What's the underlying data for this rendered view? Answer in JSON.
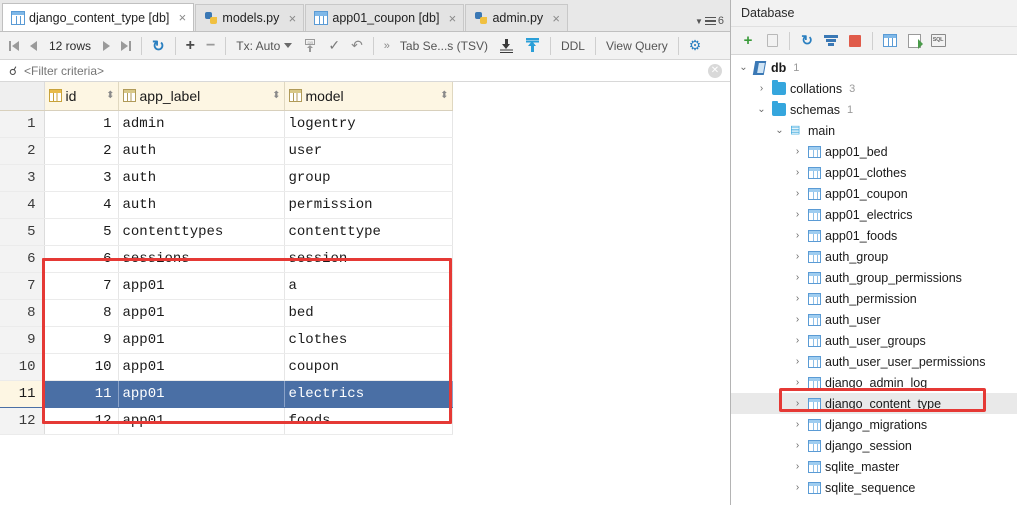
{
  "window": {
    "editor_tabs": [
      {
        "label": "django_content_type [db]",
        "icon": "db-table-icon",
        "active": true,
        "closable": true
      },
      {
        "label": "models.py",
        "icon": "python-file-icon",
        "active": false,
        "closable": true
      },
      {
        "label": "app01_coupon [db]",
        "icon": "db-table-icon",
        "active": false,
        "closable": true
      },
      {
        "label": "admin.py",
        "icon": "python-file-icon",
        "active": false,
        "closable": true
      }
    ],
    "tab_overflow_count": "6"
  },
  "toolbar": {
    "first_page_tooltip": "First page",
    "prev_page_tooltip": "Previous page",
    "row_count": "12 rows",
    "next_page_tooltip": "Next page",
    "last_page_tooltip": "Last page",
    "reload_tooltip": "Reload page",
    "add_row_label": "+",
    "delete_row_label": "−",
    "transaction_mode": "Tx: Auto",
    "export_db_tooltip": "Export to database",
    "submit_tooltip": "Submit",
    "revert_tooltip": "Revert",
    "more_label": "»",
    "csv_format": "Tab Se...s (TSV)",
    "import_tooltip": "Import data",
    "export_tooltip": "Export data",
    "ddl_label": "DDL",
    "view_query_label": "View Query",
    "settings_tooltip": "Data extractor settings"
  },
  "filter": {
    "icon": "filter-icon",
    "placeholder": "<Filter criteria>",
    "value": "",
    "clear_icon": "clear-icon"
  },
  "grid": {
    "columns": [
      {
        "key": "rownum",
        "label": "",
        "icon": null,
        "sortable": false
      },
      {
        "key": "id",
        "label": "id",
        "icon": "primary-key-column-icon",
        "sortable": true
      },
      {
        "key": "app_label",
        "label": "app_label",
        "icon": "column-icon",
        "sortable": true
      },
      {
        "key": "model",
        "label": "model",
        "icon": "column-icon",
        "sortable": true
      }
    ],
    "sort_mark": "⬍",
    "rows": [
      {
        "rownum": "1",
        "id": "1",
        "app_label": "admin",
        "model": "logentry",
        "selected": false
      },
      {
        "rownum": "2",
        "id": "2",
        "app_label": "auth",
        "model": "user",
        "selected": false
      },
      {
        "rownum": "3",
        "id": "3",
        "app_label": "auth",
        "model": "group",
        "selected": false
      },
      {
        "rownum": "4",
        "id": "4",
        "app_label": "auth",
        "model": "permission",
        "selected": false
      },
      {
        "rownum": "5",
        "id": "5",
        "app_label": "contenttypes",
        "model": "contenttype",
        "selected": false
      },
      {
        "rownum": "6",
        "id": "6",
        "app_label": "sessions",
        "model": "session",
        "selected": false
      },
      {
        "rownum": "7",
        "id": "7",
        "app_label": "app01",
        "model": "a",
        "selected": false
      },
      {
        "rownum": "8",
        "id": "8",
        "app_label": "app01",
        "model": "bed",
        "selected": false
      },
      {
        "rownum": "9",
        "id": "9",
        "app_label": "app01",
        "model": "clothes",
        "selected": false
      },
      {
        "rownum": "10",
        "id": "10",
        "app_label": "app01",
        "model": "coupon",
        "selected": false
      },
      {
        "rownum": "11",
        "id": "11",
        "app_label": "app01",
        "model": "electrics",
        "selected": true
      },
      {
        "rownum": "12",
        "id": "12",
        "app_label": "app01",
        "model": "foods",
        "selected": false
      }
    ],
    "selection_color": "#4a6fa5",
    "highlight_box_color": "#e53935"
  },
  "database_panel": {
    "title": "Database",
    "toolbar": [
      {
        "name": "add-data-source-button",
        "icon": "plus-icon"
      },
      {
        "name": "duplicate-button",
        "icon": "copy-icon"
      },
      {
        "name": "synchronize-button",
        "icon": "refresh-icon"
      },
      {
        "name": "filter-schemas-button",
        "icon": "filter-icon"
      },
      {
        "name": "stop-button",
        "icon": "stop-icon"
      },
      {
        "name": "data-editor-button",
        "icon": "table-icon"
      },
      {
        "name": "modify-button",
        "icon": "script-icon"
      },
      {
        "name": "open-console-button",
        "icon": "sql-console-icon"
      }
    ],
    "tree": [
      {
        "label": "db",
        "count": "1",
        "indent": 0,
        "twisty": "⌄",
        "icon": "database-icon",
        "bold": true,
        "highlighted": false
      },
      {
        "label": "collations",
        "count": "3",
        "indent": 1,
        "twisty": "›",
        "icon": "folder-icon",
        "bold": false,
        "highlighted": false
      },
      {
        "label": "schemas",
        "count": "1",
        "indent": 1,
        "twisty": "⌄",
        "icon": "folder-icon",
        "bold": false,
        "highlighted": false
      },
      {
        "label": "main",
        "count": "",
        "indent": 2,
        "twisty": "⌄",
        "icon": "schema-icon",
        "bold": false,
        "highlighted": false
      },
      {
        "label": "app01_bed",
        "count": "",
        "indent": 3,
        "twisty": "›",
        "icon": "table-icon",
        "bold": false,
        "highlighted": false
      },
      {
        "label": "app01_clothes",
        "count": "",
        "indent": 3,
        "twisty": "›",
        "icon": "table-icon",
        "bold": false,
        "highlighted": false
      },
      {
        "label": "app01_coupon",
        "count": "",
        "indent": 3,
        "twisty": "›",
        "icon": "table-icon",
        "bold": false,
        "highlighted": false
      },
      {
        "label": "app01_electrics",
        "count": "",
        "indent": 3,
        "twisty": "›",
        "icon": "table-icon",
        "bold": false,
        "highlighted": false
      },
      {
        "label": "app01_foods",
        "count": "",
        "indent": 3,
        "twisty": "›",
        "icon": "table-icon",
        "bold": false,
        "highlighted": false
      },
      {
        "label": "auth_group",
        "count": "",
        "indent": 3,
        "twisty": "›",
        "icon": "table-icon",
        "bold": false,
        "highlighted": false
      },
      {
        "label": "auth_group_permissions",
        "count": "",
        "indent": 3,
        "twisty": "›",
        "icon": "table-icon",
        "bold": false,
        "highlighted": false
      },
      {
        "label": "auth_permission",
        "count": "",
        "indent": 3,
        "twisty": "›",
        "icon": "table-icon",
        "bold": false,
        "highlighted": false
      },
      {
        "label": "auth_user",
        "count": "",
        "indent": 3,
        "twisty": "›",
        "icon": "table-icon",
        "bold": false,
        "highlighted": false
      },
      {
        "label": "auth_user_groups",
        "count": "",
        "indent": 3,
        "twisty": "›",
        "icon": "table-icon",
        "bold": false,
        "highlighted": false
      },
      {
        "label": "auth_user_user_permissions",
        "count": "",
        "indent": 3,
        "twisty": "›",
        "icon": "table-icon",
        "bold": false,
        "highlighted": false
      },
      {
        "label": "django_admin_log",
        "count": "",
        "indent": 3,
        "twisty": "›",
        "icon": "table-icon",
        "bold": false,
        "highlighted": false
      },
      {
        "label": "django_content_type",
        "count": "",
        "indent": 3,
        "twisty": "›",
        "icon": "table-icon",
        "bold": false,
        "highlighted": true
      },
      {
        "label": "django_migrations",
        "count": "",
        "indent": 3,
        "twisty": "›",
        "icon": "table-icon",
        "bold": false,
        "highlighted": false
      },
      {
        "label": "django_session",
        "count": "",
        "indent": 3,
        "twisty": "›",
        "icon": "table-icon",
        "bold": false,
        "highlighted": false
      },
      {
        "label": "sqlite_master",
        "count": "",
        "indent": 3,
        "twisty": "›",
        "icon": "table-icon",
        "bold": false,
        "highlighted": false
      },
      {
        "label": "sqlite_sequence",
        "count": "",
        "indent": 3,
        "twisty": "›",
        "icon": "table-icon",
        "bold": false,
        "highlighted": false
      }
    ]
  }
}
